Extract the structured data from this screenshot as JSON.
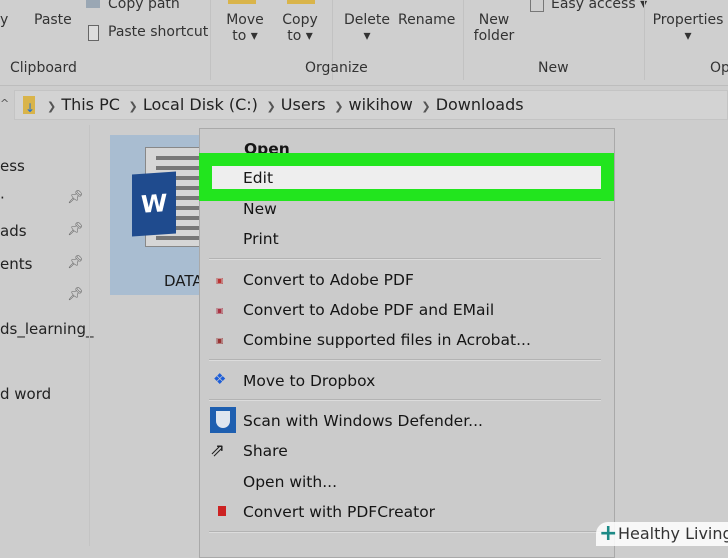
{
  "ribbon": {
    "copy_partial": "y",
    "paste": "Paste",
    "copy_path": "Copy path",
    "paste_shortcut": "Paste shortcut",
    "move_to": "Move",
    "move_to_2": "to",
    "copy_to": "Copy",
    "copy_to_2": "to",
    "delete": "Delete",
    "rename": "Rename",
    "new_folder": "New",
    "new_folder_2": "folder",
    "easy_access": "Easy access",
    "properties": "Properties",
    "groups": {
      "clipboard": "Clipboard",
      "organize": "Organize",
      "new": "New",
      "open_partial": "Op"
    }
  },
  "address": {
    "crumbs": [
      "This PC",
      "Local Disk (C:)",
      "Users",
      "wikihow",
      "Downloads"
    ]
  },
  "sidebar": {
    "items": [
      "ess",
      "",
      "ads",
      "ents",
      "",
      "ds_learning_",
      "d word"
    ]
  },
  "file": {
    "name": "DATA",
    "icon": "word-document-icon"
  },
  "context_menu": {
    "items": [
      "Open",
      "Edit",
      "New",
      "Print",
      "Convert to Adobe PDF",
      "Convert to Adobe PDF and EMail",
      "Combine supported files in Acrobat...",
      "Move to Dropbox",
      "Scan with Windows Defender...",
      "Share",
      "Open with...",
      "Convert with PDFCreator"
    ],
    "highlight_color": "#22e51e"
  },
  "watermark": {
    "text": "Healthy Living"
  }
}
